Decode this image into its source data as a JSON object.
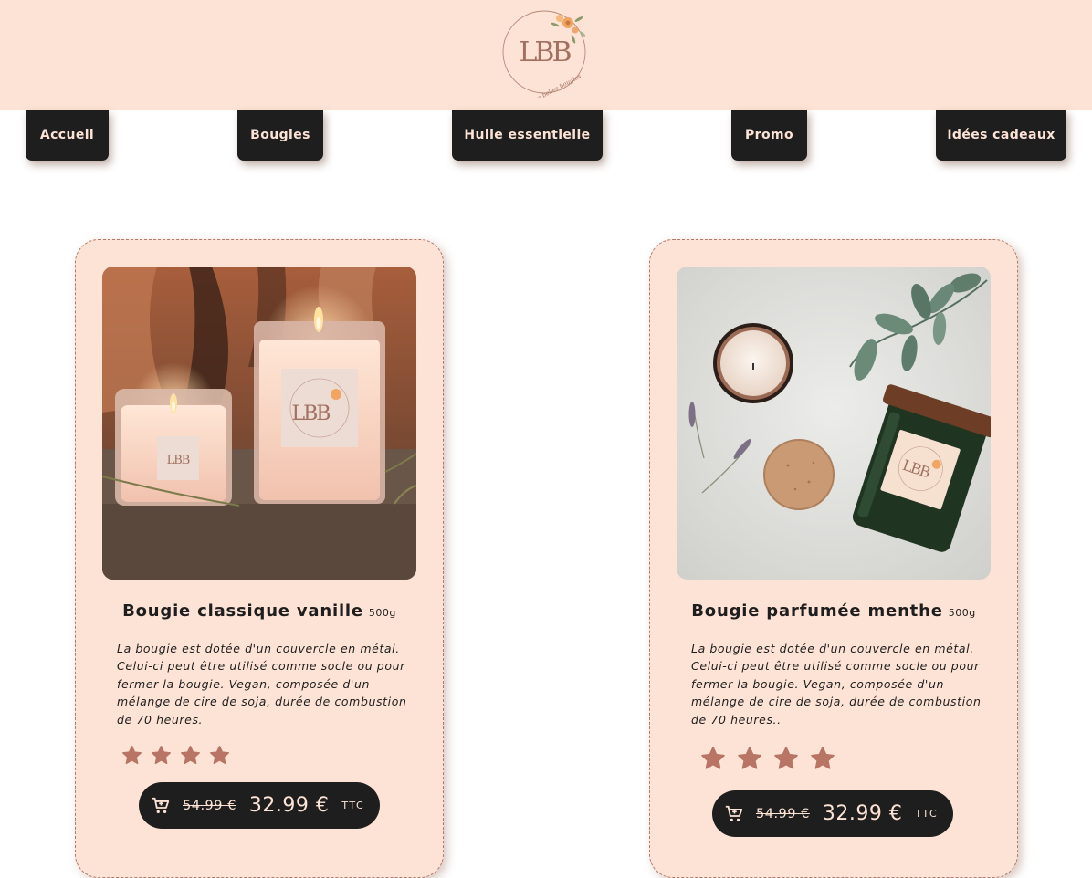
{
  "header": {
    "logo_monogram": "LBB",
    "logo_tagline": "Les belles bougies"
  },
  "nav": [
    {
      "label": "Accueil"
    },
    {
      "label": "Bougies"
    },
    {
      "label": "Huile essentielle"
    },
    {
      "label": "Promo"
    },
    {
      "label": "Idées cadeaux"
    }
  ],
  "products": [
    {
      "name": "Bougie classique vanille",
      "weight": "500g",
      "description": "La bougie est dotée d'un couvercle en métal. Celui-ci peut être utilisé comme socle ou pour fermer la bougie. Vegan, composée d'un mélange de cire de soja, durée de combustion de 70 heures.",
      "rating": 4,
      "old_price": "54.99 €",
      "price": "32.99 €",
      "tax_label": "TTC",
      "image": "two-lit-candles-photo"
    },
    {
      "name": "Bougie parfumée menthe",
      "weight": "500g",
      "description": "La bougie est dotée d'un couvercle en métal. Celui-ci peut être utilisé comme socle ou pour fermer la bougie. Vegan, composée d'un mélange de cire de soja, durée de combustion de 70 heures..",
      "rating": 4,
      "old_price": "54.99 €",
      "price": "32.99 €",
      "tax_label": "TTC",
      "image": "green-jar-candle-eucalyptus-photo"
    }
  ],
  "colors": {
    "header_bg": "#fde3d5",
    "card_bg": "#fde3d5",
    "button_bg": "#1e1e1e",
    "button_text": "#fde3d5",
    "star": "#b87565"
  },
  "icons": {
    "cart": "shopping-cart-icon",
    "star": "star-icon"
  }
}
